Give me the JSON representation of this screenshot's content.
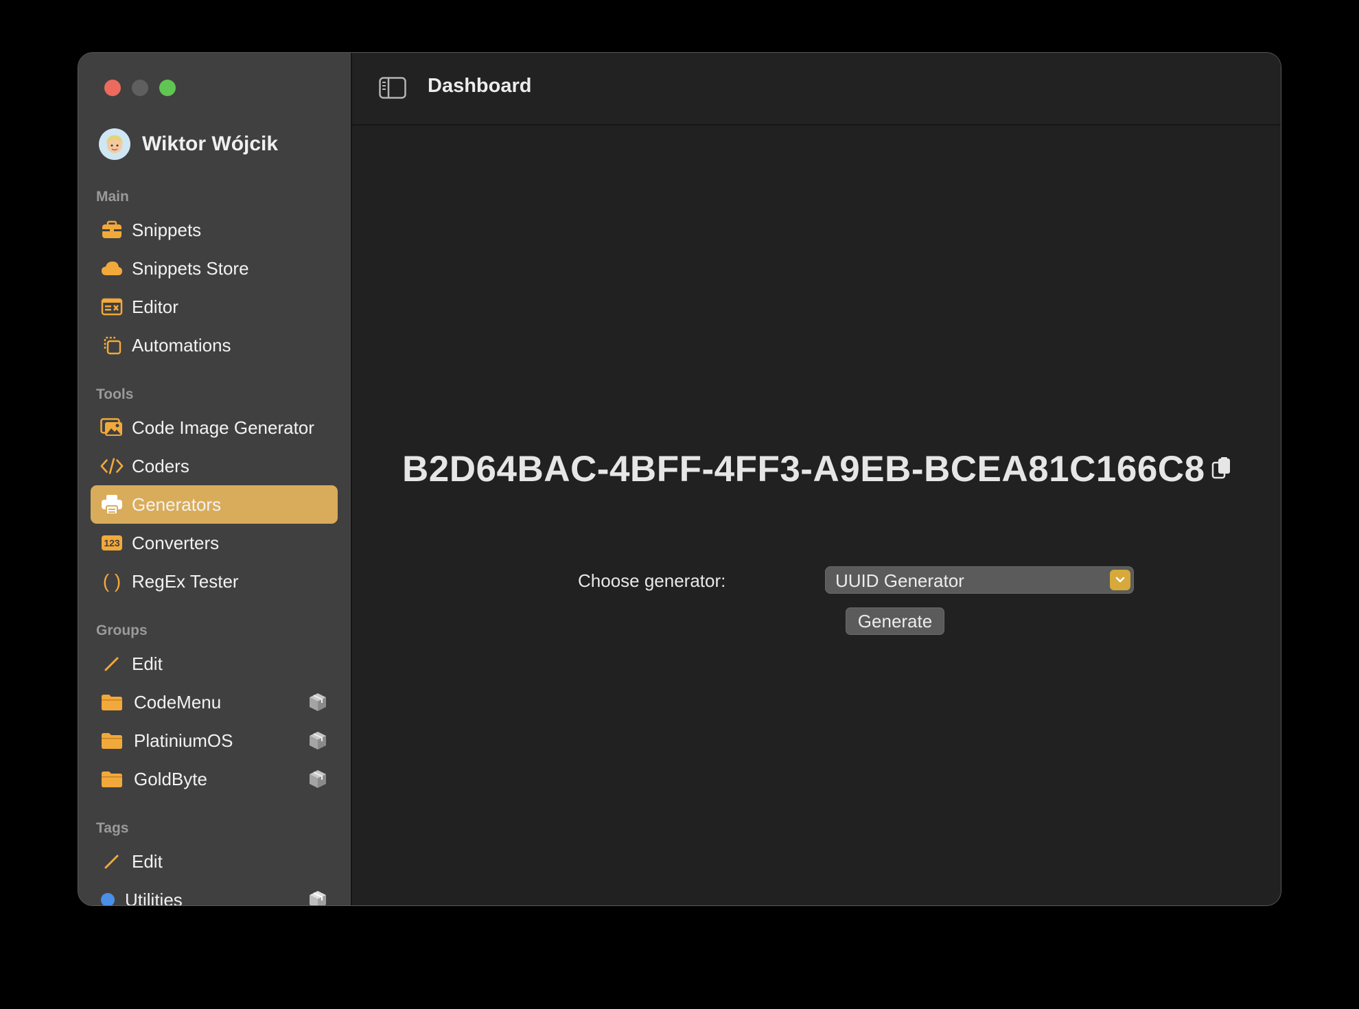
{
  "window": {
    "title": "Dashboard"
  },
  "profile": {
    "name": "Wiktor Wójcik"
  },
  "colors": {
    "accent": "#d9ac5b",
    "icon": "#f2a93b",
    "window_bg": "#212121",
    "sidebar_bg": "#404040",
    "tag_blue": "#4a8fe8"
  },
  "sidebar": {
    "main_title": "Main",
    "main": [
      {
        "label": "Snippets",
        "icon": "toolbox-icon"
      },
      {
        "label": "Snippets Store",
        "icon": "cloud-icon"
      },
      {
        "label": "Editor",
        "icon": "editor-icon"
      },
      {
        "label": "Automations",
        "icon": "automations-icon"
      }
    ],
    "tools_title": "Tools",
    "tools": [
      {
        "label": "Code Image Generator",
        "icon": "photo-icon"
      },
      {
        "label": "Coders",
        "icon": "code-icon"
      },
      {
        "label": "Generators",
        "icon": "printer-icon",
        "selected": true
      },
      {
        "label": "Converters",
        "icon": "number-123-icon",
        "icon_text": "123"
      },
      {
        "label": "RegEx Tester",
        "icon": "parentheses-icon",
        "icon_text": "( )"
      }
    ],
    "groups_title": "Groups",
    "groups": [
      {
        "label": "Edit",
        "icon": "pencil-icon"
      },
      {
        "label": "CodeMenu",
        "icon": "folder-icon"
      },
      {
        "label": "PlatiniumOS",
        "icon": "folder-icon"
      },
      {
        "label": "GoldByte",
        "icon": "folder-icon"
      }
    ],
    "tags_title": "Tags",
    "tags": [
      {
        "label": "Edit",
        "icon": "pencil-icon"
      },
      {
        "label": "Utilities",
        "icon": "blue-dot-icon"
      }
    ]
  },
  "main": {
    "generated_value": "B2D64BAC-4BFF-4FF3-A9EB-BCEA81C166C8",
    "choose_label": "Choose generator:",
    "selected_generator": "UUID Generator",
    "generate_label": "Generate"
  }
}
